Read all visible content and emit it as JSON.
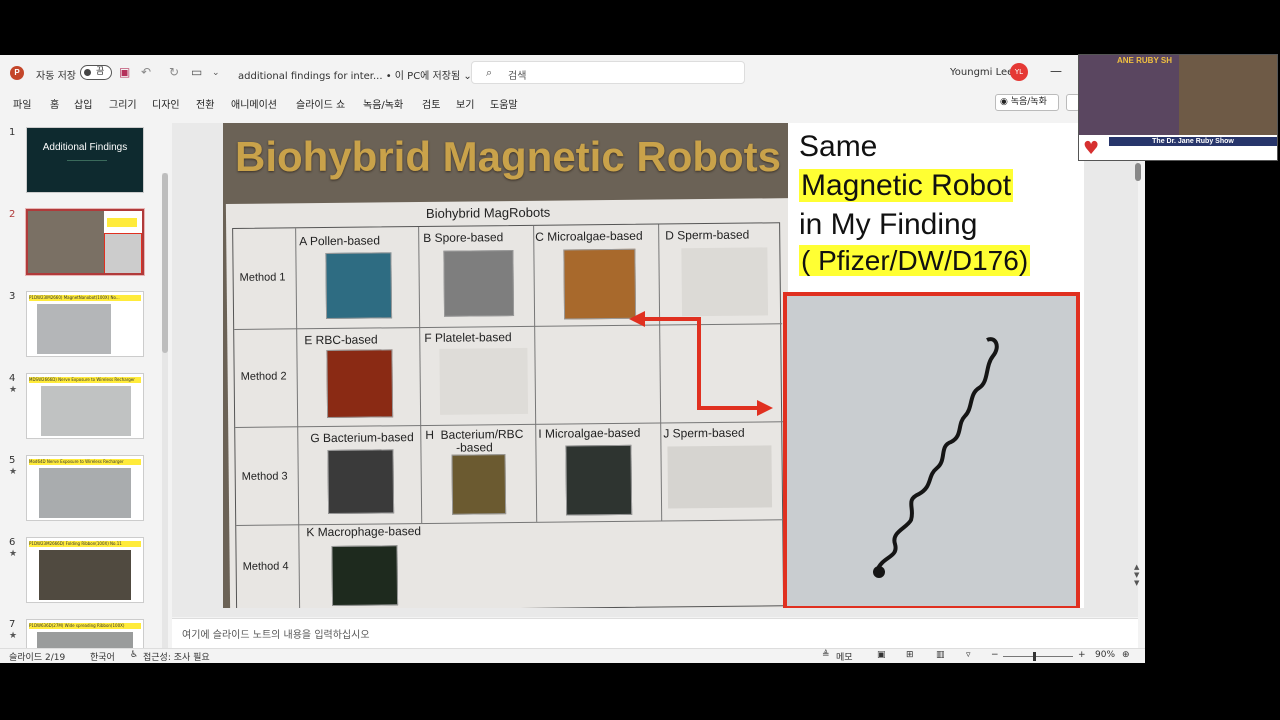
{
  "titlebar": {
    "logo": "P",
    "autosave_label": "자동 저장",
    "toggle_label": "끔",
    "doc_title": "additional findings for inter...  •  이 PC에 저장됨 ⌄",
    "search_placeholder": "검색",
    "user_name": "Youngmi Lee",
    "user_initials": "YL",
    "minimize": "—",
    "icons": [
      "save-icon",
      "undo-icon",
      "redo-icon",
      "present-icon",
      "customize-icon"
    ]
  },
  "menu": {
    "items": [
      "파일",
      "홈",
      "삽입",
      "그리기",
      "디자인",
      "전환",
      "애니메이션",
      "슬라이드 쇼",
      "녹음/녹화",
      "검토",
      "보기",
      "도움말"
    ],
    "record_button": "◉ 녹음/녹화"
  },
  "thumbnails": [
    {
      "num": "1",
      "star": "",
      "title": "Additional Findings",
      "bar": ""
    },
    {
      "num": "2",
      "star": "",
      "title": "",
      "bar": ""
    },
    {
      "num": "3",
      "star": "",
      "title": "",
      "bar": "P1DW23IM2660) MagnetNanobot(100X) No..."
    },
    {
      "num": "4",
      "star": "★",
      "title": "",
      "bar": "MDSW2666D) Nerve Exposure to Wireless Recharger"
    },
    {
      "num": "5",
      "star": "★",
      "title": "",
      "bar": "Mod64D Nerve Exposure to Wireless Recharger"
    },
    {
      "num": "6",
      "star": "★",
      "title": "",
      "bar": "P1DW23M2666D) Folding Ribbon(100X) No.11"
    },
    {
      "num": "7",
      "star": "★",
      "title": "",
      "bar": "P1DW636D(27M) Wide spreading Ribbon(100X)"
    }
  ],
  "slide": {
    "photo_title": "Biohybrid Magnetic Robots",
    "table_title": "Biohybrid MagRobots",
    "methods": [
      "Method 1",
      "Method 2",
      "Method 3",
      "Method 4"
    ],
    "cells": [
      {
        "label": "A  Pollen-based"
      },
      {
        "label": "B  Spore-based"
      },
      {
        "label": "C  Microalgae-based"
      },
      {
        "label": "D  Sperm-based"
      },
      {
        "label": "E  RBC-based"
      },
      {
        "label": "F  Platelet-based"
      },
      {
        "label": "G  Bacterium-based"
      },
      {
        "label": "H  Bacterium/RBC\n-based"
      },
      {
        "label": "I  Microalgae-based"
      },
      {
        "label": "J  Sperm-based"
      },
      {
        "label": "K  Macrophage-based"
      }
    ],
    "side_lines": [
      "Same",
      "Magnetic Robot",
      "in My Finding",
      "( Pfizer/DW/D176)"
    ],
    "accent_red": "#e03020",
    "highlight": "#ffff33"
  },
  "notes_placeholder": "여기에 슬라이드 노트의 내용을 입력하십시오",
  "status": {
    "slide_count": "슬라이드 2/19",
    "language": "한국어",
    "accessibility": "접근성: 조사 필요",
    "notes_btn": "메모",
    "zoom": "90%"
  },
  "webcam": {
    "show_name": "The Dr. Jane Ruby Show",
    "top_text": "ANE RUBY SH"
  }
}
